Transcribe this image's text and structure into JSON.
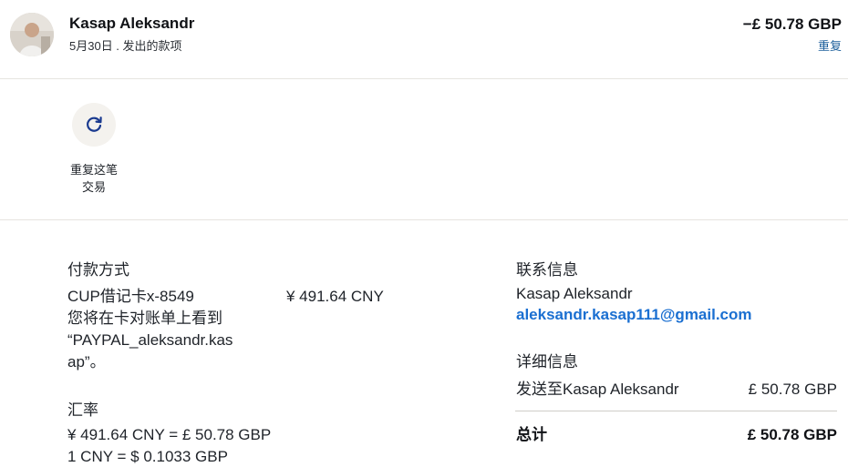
{
  "header": {
    "name": "Kasap Aleksandr",
    "subline": "5月30日 . 发出的款项",
    "amount": "−£ 50.78 GBP",
    "repeat_link": "重复"
  },
  "action": {
    "label_line1": "重复这笔",
    "label_line2": "交易",
    "icon": "refresh-icon"
  },
  "payment": {
    "title": "付款方式",
    "card": "CUP借记卡x-8549",
    "card_amount": "¥ 491.64 CNY",
    "statement_line1": "您将在卡对账单上看到",
    "statement_line2": "“PAYPAL_aleksandr.kas",
    "statement_line3": "ap”。"
  },
  "exchange": {
    "title": "汇率",
    "line1": "¥ 491.64 CNY = £ 50.78 GBP",
    "line2": "1 CNY = $ 0.1033 GBP"
  },
  "contact": {
    "title": "联系信息",
    "name": "Kasap Aleksandr",
    "email": "aleksandr.kasap111@gmail.com"
  },
  "details": {
    "title": "详细信息",
    "sent_to_label": "发送至Kasap Aleksandr",
    "sent_to_amount": "£ 50.78 GBP",
    "total_label": "总计",
    "total_amount": "£ 50.78 GBP"
  },
  "colors": {
    "link": "#1d5f9b",
    "email": "#1a6fd1",
    "text": "#1f2329"
  }
}
